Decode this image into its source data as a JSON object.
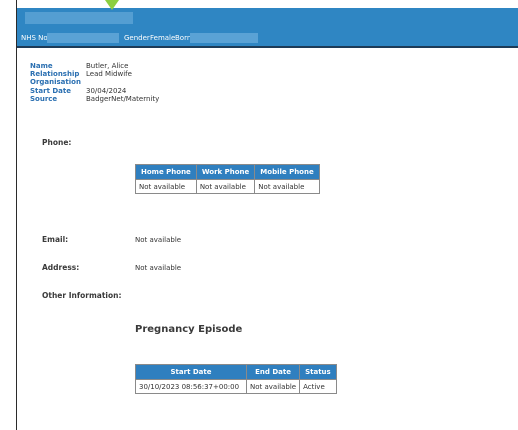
{
  "patient_bar": {
    "nhs_label": "NHS No",
    "gender_label": "Gender",
    "gender_value": "Female",
    "born_label": "Born"
  },
  "summary": {
    "name_label": "Name",
    "name_value": "Butler, Alice",
    "relationship_label": "Relationship",
    "relationship_value": "Lead Midwife",
    "organisation_label": "Organisation",
    "organisation_value": "",
    "start_date_label": "Start Date",
    "start_date_value": "30/04/2024",
    "source_label": "Source",
    "source_value": "BadgerNet/Maternity"
  },
  "phone": {
    "label": "Phone:",
    "headers": [
      "Home Phone",
      "Work Phone",
      "Mobile Phone"
    ],
    "row": [
      "Not available",
      "Not available",
      "Not available"
    ]
  },
  "email": {
    "label": "Email:",
    "value": "Not available"
  },
  "address": {
    "label": "Address:",
    "value": "Not available"
  },
  "other": {
    "label": "Other Information:"
  },
  "pregnancy": {
    "title": "Pregnancy Episode",
    "headers": [
      "Start Date",
      "End Date",
      "Status"
    ],
    "row": [
      "30/10/2023 08:56:37+00:00",
      "Not available",
      "Active"
    ]
  },
  "colors": {
    "header_bg": "#2f86c3",
    "table_header_bg": "#2f7fbf",
    "label_blue": "#2a6fb1"
  }
}
